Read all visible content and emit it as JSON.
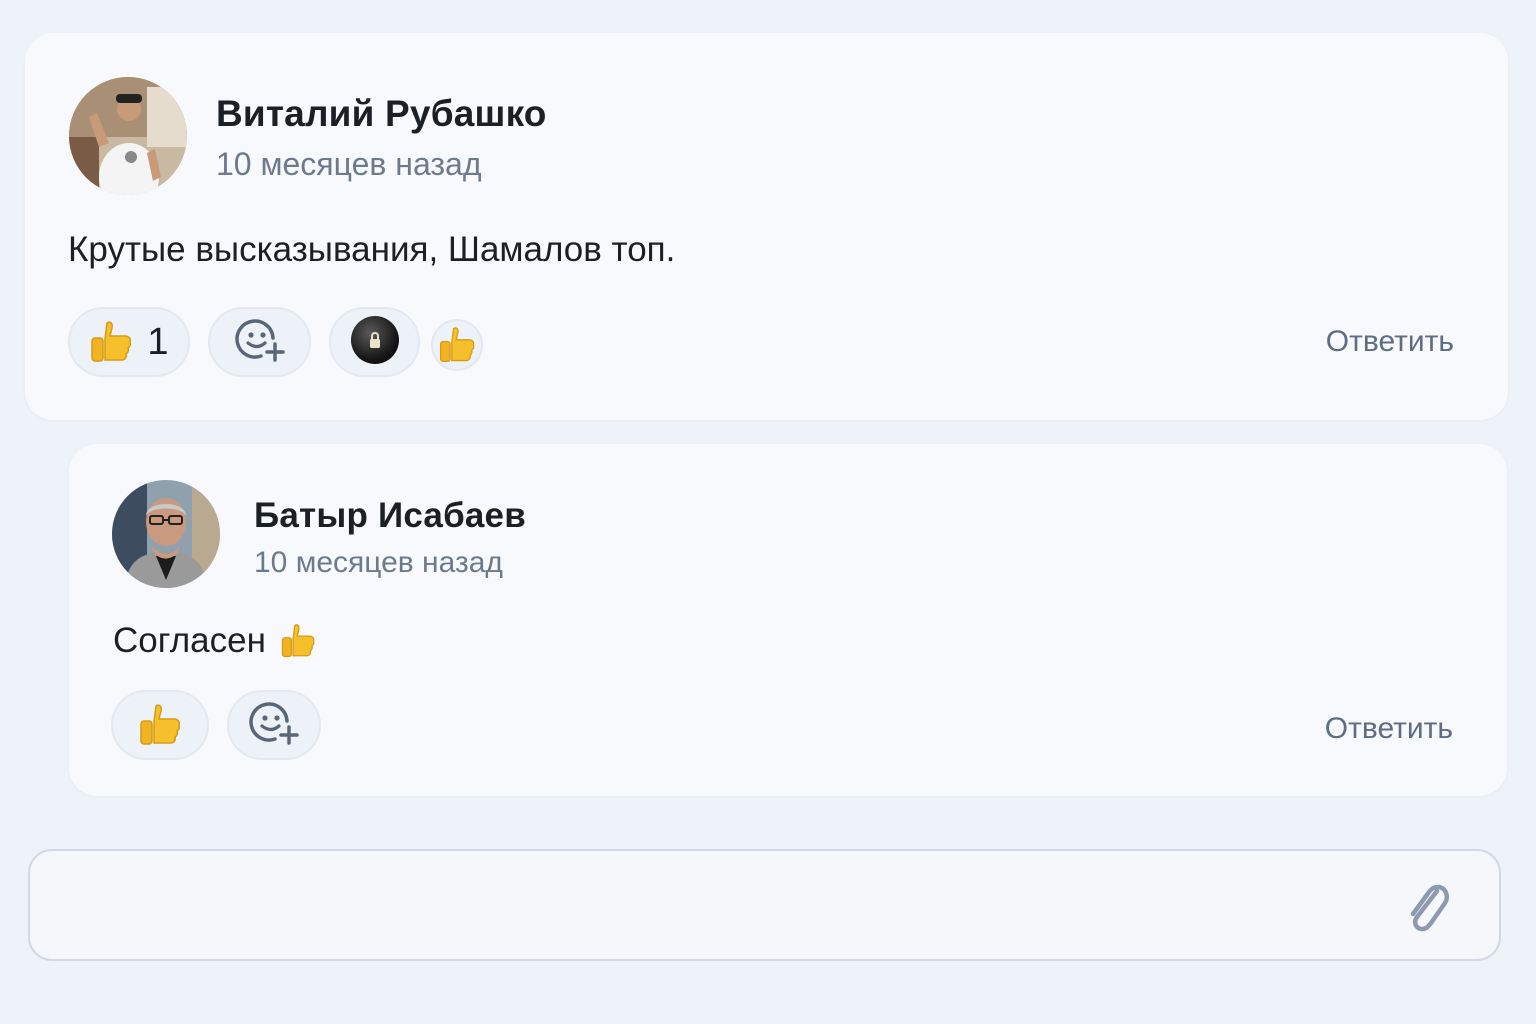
{
  "comments": [
    {
      "author": "Виталий Рубашко",
      "time": "10 месяцев назад",
      "text": "Крутые высказывания, Шамалов топ.",
      "reactions": [
        {
          "emoji": "thumbs-up",
          "count": "1"
        },
        {
          "emoji": "add-reaction"
        },
        {
          "emoji": "lock-sticker"
        },
        {
          "emoji": "thumbs-up"
        }
      ],
      "reply_label": "Ответить"
    },
    {
      "author": "Батыр Исабаев",
      "time": "10 месяцев назад",
      "text": "Согласен",
      "text_emoji": "thumbs-up",
      "reactions": [
        {
          "emoji": "thumbs-up"
        },
        {
          "emoji": "add-reaction"
        }
      ],
      "reply_label": "Ответить"
    }
  ],
  "composer": {
    "value": "",
    "placeholder": "",
    "attach_icon": "paperclip-icon"
  },
  "colors": {
    "background": "#eef2f9",
    "card": "#f8f9fc",
    "muted_text": "#6d7a8e",
    "link": "#5e6c84",
    "thumb": "#f5c02b"
  }
}
